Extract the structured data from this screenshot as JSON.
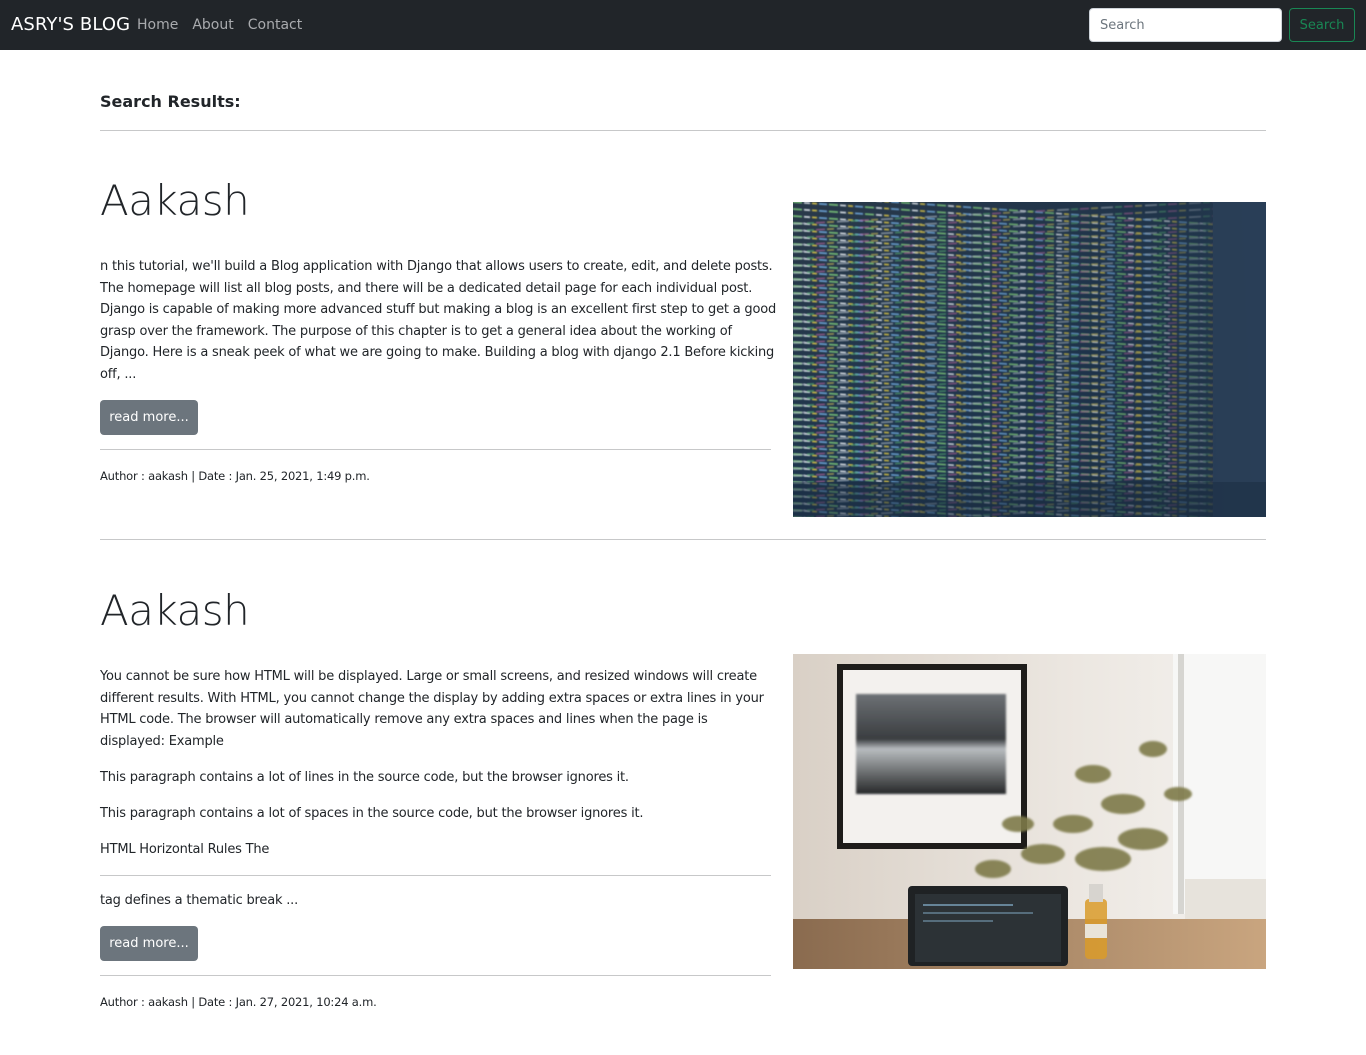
{
  "navbar": {
    "brand": "ASRY'S BLOG",
    "links": [
      "Home",
      "About",
      "Contact"
    ],
    "search_placeholder": "Search",
    "search_button": "Search",
    "accent_color": "#198754"
  },
  "page": {
    "heading": "Search Results:"
  },
  "posts": [
    {
      "title": "Aakash",
      "paragraphs": [
        "n this tutorial, we'll build a Blog application with Django that allows users to create, edit, and delete posts. The homepage will list all blog posts, and there will be a dedicated detail page for each individual post. Django is capable of making more advanced stuff but making a blog is an excellent first step to get a good grasp over the framework. The purpose of this chapter is to get a general idea about the working of Django. Here is a sneak peek of what we are going to make. Building a blog with django 2.1 Before kicking off, ..."
      ],
      "read_more": "read more...",
      "meta": "Author : aakash | Date : Jan. 25, 2021, 1:49 p.m.",
      "image": "code-screen-image"
    },
    {
      "title": "Aakash",
      "paragraphs": [
        "You cannot be sure how HTML will be displayed. Large or small screens, and resized windows will create different results. With HTML, you cannot change the display by adding extra spaces or extra lines in your HTML code. The browser will automatically remove any extra spaces and lines when the page is displayed: Example",
        "This paragraph contains a lot of lines in the source code, but the browser ignores it.",
        "This paragraph contains a lot of spaces in the source code, but the browser ignores it.",
        "HTML Horizontal Rules The"
      ],
      "after_rule": "tag defines a thematic break ...",
      "read_more": "read more...",
      "meta": "Author : aakash | Date : Jan. 27, 2021, 10:24 a.m.",
      "image": "desk-laptop-plant-image"
    }
  ]
}
